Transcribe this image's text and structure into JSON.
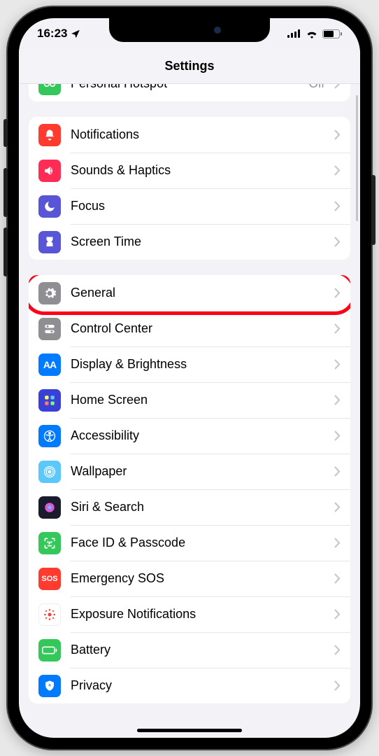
{
  "status": {
    "time": "16:23"
  },
  "nav": {
    "title": "Settings"
  },
  "group0": {
    "row0": {
      "label": "Personal Hotspot",
      "detail": "Off"
    }
  },
  "group1": {
    "row0": {
      "label": "Notifications"
    },
    "row1": {
      "label": "Sounds & Haptics"
    },
    "row2": {
      "label": "Focus"
    },
    "row3": {
      "label": "Screen Time"
    }
  },
  "group2": {
    "row0": {
      "label": "General"
    },
    "row1": {
      "label": "Control Center"
    },
    "row2": {
      "label": "Display & Brightness"
    },
    "row3": {
      "label": "Home Screen"
    },
    "row4": {
      "label": "Accessibility"
    },
    "row5": {
      "label": "Wallpaper"
    },
    "row6": {
      "label": "Siri & Search"
    },
    "row7": {
      "label": "Face ID & Passcode"
    },
    "row8": {
      "label": "Emergency SOS"
    },
    "row9": {
      "label": "Exposure Notifications"
    },
    "row10": {
      "label": "Battery"
    },
    "row11": {
      "label": "Privacy"
    }
  },
  "colors": {
    "green": "#34c759",
    "red": "#ff3b30",
    "pink": "#ff2d55",
    "purple": "#5856d6",
    "gray": "#8e8e93",
    "blue": "#007aff",
    "lightblue": "#5ac8fa",
    "siri": "#111",
    "white": "#ffffff",
    "sos": "#ff3b30"
  },
  "highlighted_row": "general"
}
